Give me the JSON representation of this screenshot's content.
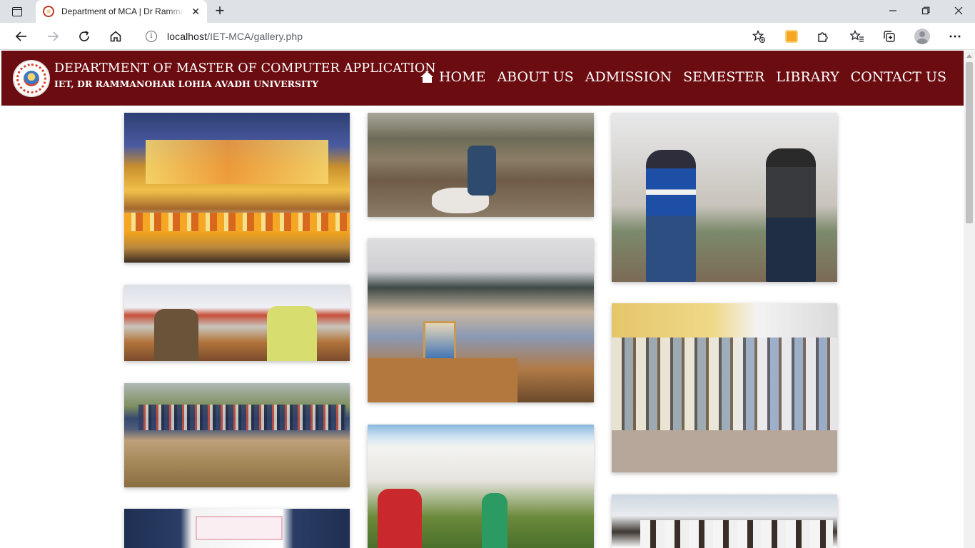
{
  "browser": {
    "tab_title": "Department of MCA | Dr Rammanohar Lohia Avadh University",
    "url_host": "localhost",
    "url_path": "/IET-MCA/gallery.php"
  },
  "site": {
    "title": "DEPARTMENT OF MASTER OF COMPUTER APPLICATION",
    "subtitle": "IET, DR RAMMANOHAR LOHIA AVADH UNIVERSITY",
    "nav": [
      "HOME",
      "ABOUT US",
      "ADMISSION",
      "SEMESTER",
      "LIBRARY",
      "CONTACT US"
    ]
  },
  "gallery": {
    "photos": [
      {
        "name": "convocation-ceremony-photo"
      },
      {
        "name": "tree-planting-photo"
      },
      {
        "name": "statue-visit-photo"
      },
      {
        "name": "award-presentation-photo"
      },
      {
        "name": "group-outdoor-photo"
      },
      {
        "name": "banner-event-photo"
      },
      {
        "name": "classroom-group-photo"
      },
      {
        "name": "campus-plantation-photo"
      },
      {
        "name": "students-group-photo"
      },
      {
        "name": "campus-students-photo"
      }
    ]
  },
  "colors": {
    "header_bg": "#6b0c10",
    "header_text": "#ffffff"
  },
  "icons": [
    "tab-actions-icon",
    "favicon-icon",
    "close-icon",
    "new-tab-icon",
    "minimize-icon",
    "maximize-icon",
    "window-close-icon",
    "back-icon",
    "forward-icon",
    "reload-icon",
    "home-icon",
    "info-icon",
    "add-favorite-icon",
    "extension-icon",
    "puzzle-icon",
    "favorites-icon",
    "collections-icon",
    "profile-icon",
    "more-icon",
    "site-home-icon",
    "university-logo-icon"
  ]
}
